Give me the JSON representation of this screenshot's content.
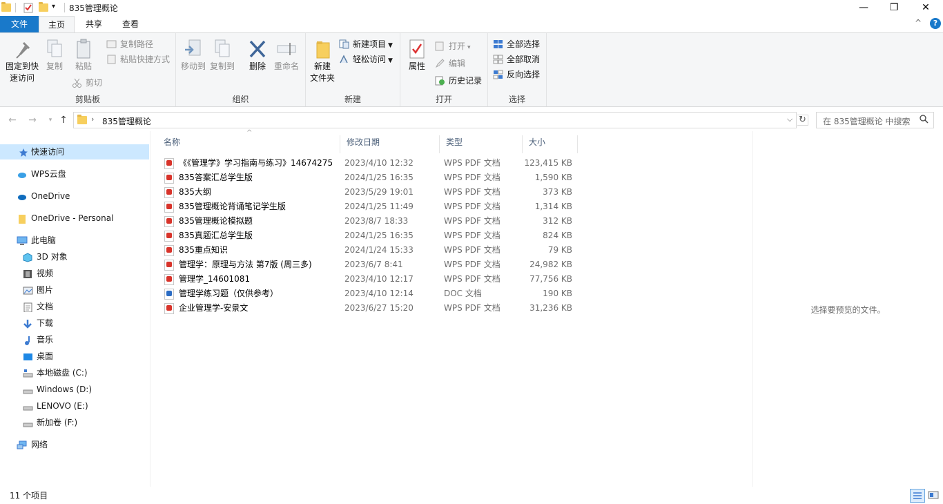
{
  "window": {
    "title": "835管理概论",
    "minimize": "—",
    "maximize": "❐",
    "close": "✕"
  },
  "tabs": {
    "file": "文件",
    "home": "主页",
    "share": "共享",
    "view": "查看",
    "collapse": "^",
    "help": "?"
  },
  "ribbon": {
    "clipboard": {
      "label": "剪贴板",
      "pin": "固定到快\n速访问",
      "pin_l1": "固定到快",
      "pin_l2": "速访问",
      "copy": "复制",
      "paste": "粘贴",
      "copy_path": "复制路径",
      "paste_shortcut": "粘贴快捷方式",
      "cut": "剪切"
    },
    "organize": {
      "label": "组织",
      "move_to": "移动到",
      "copy_to": "复制到",
      "delete": "删除",
      "rename": "重命名"
    },
    "new": {
      "label": "新建",
      "new_folder_l1": "新建",
      "new_folder_l2": "文件夹",
      "new_item": "新建项目",
      "easy_access": "轻松访问"
    },
    "open": {
      "label": "打开",
      "properties": "属性",
      "open": "打开",
      "edit": "编辑",
      "history": "历史记录"
    },
    "select": {
      "label": "选择",
      "select_all": "全部选择",
      "select_none": "全部取消",
      "invert": "反向选择"
    }
  },
  "address": {
    "path": "835管理概论",
    "search_placeholder": "在 835管理概论 中搜索"
  },
  "sidebar": {
    "quick_access": "快速访问",
    "wps_cloud": "WPS云盘",
    "onedrive": "OneDrive",
    "onedrive_personal": "OneDrive - Personal",
    "this_pc": "此电脑",
    "objects3d": "3D 对象",
    "videos": "视频",
    "pictures": "图片",
    "documents": "文档",
    "downloads": "下载",
    "music": "音乐",
    "desktop": "桌面",
    "drive_c": "本地磁盘 (C:)",
    "drive_d": "Windows (D:)",
    "drive_e": "LENOVO (E:)",
    "drive_f": "新加卷 (F:)",
    "network": "网络"
  },
  "columns": {
    "name": "名称",
    "date": "修改日期",
    "type": "类型",
    "size": "大小"
  },
  "files": [
    {
      "name": "《《管理学》学习指南与练习》14674275",
      "date": "2023/4/10 12:32",
      "type": "WPS PDF 文档",
      "size": "123,415 KB",
      "icon": "pdf-icon"
    },
    {
      "name": "835答案汇总学生版",
      "date": "2024/1/25 16:35",
      "type": "WPS PDF 文档",
      "size": "1,590 KB",
      "icon": "pdf-icon"
    },
    {
      "name": "835大纲",
      "date": "2023/5/29 19:01",
      "type": "WPS PDF 文档",
      "size": "373 KB",
      "icon": "pdf-icon"
    },
    {
      "name": "835管理概论背诵笔记学生版",
      "date": "2024/1/25 11:49",
      "type": "WPS PDF 文档",
      "size": "1,314 KB",
      "icon": "pdf-icon"
    },
    {
      "name": "835管理概论模拟题",
      "date": "2023/8/7 18:33",
      "type": "WPS PDF 文档",
      "size": "312 KB",
      "icon": "pdf-icon"
    },
    {
      "name": "835真题汇总学生版",
      "date": "2024/1/25 16:35",
      "type": "WPS PDF 文档",
      "size": "824 KB",
      "icon": "pdf-icon"
    },
    {
      "name": "835重点知识",
      "date": "2024/1/24 15:33",
      "type": "WPS PDF 文档",
      "size": "79 KB",
      "icon": "pdf-icon"
    },
    {
      "name": "管理学：原理与方法 第7版 (周三多)",
      "date": "2023/6/7 8:41",
      "type": "WPS PDF 文档",
      "size": "24,982 KB",
      "icon": "pdf-icon"
    },
    {
      "name": "管理学_14601081",
      "date": "2023/4/10 12:17",
      "type": "WPS PDF 文档",
      "size": "77,756 KB",
      "icon": "pdf-icon"
    },
    {
      "name": "管理学练习题（仅供参考）",
      "date": "2023/4/10 12:14",
      "type": "DOC 文档",
      "size": "190 KB",
      "icon": "doc-icon"
    },
    {
      "name": "企业管理学-安景文",
      "date": "2023/6/27 15:20",
      "type": "WPS PDF 文档",
      "size": "31,236 KB",
      "icon": "pdf-icon"
    }
  ],
  "preview": {
    "message": "选择要预览的文件。"
  },
  "status": {
    "count": "11 个项目"
  },
  "colors": {
    "file_tab": "#1979ca",
    "selection": "#cce8ff",
    "folder": "#f7cf5e",
    "pdf": "#d8332a"
  }
}
